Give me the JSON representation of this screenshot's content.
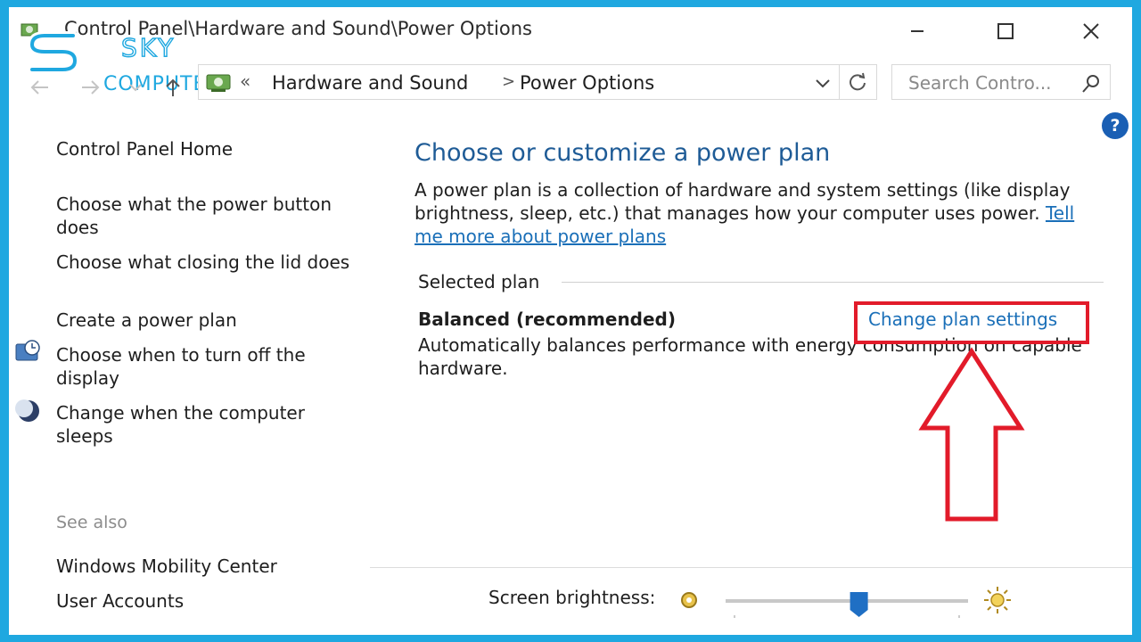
{
  "window": {
    "title": "Control Panel\\Hardware and Sound\\Power Options"
  },
  "logo": {
    "line1": "SKY",
    "line2": "COMPUTER"
  },
  "address_bar": {
    "overflow": "«",
    "crumbs": [
      "Hardware and Sound",
      "Power Options"
    ],
    "separator": ">"
  },
  "search": {
    "placeholder": "Search Contro..."
  },
  "help": {
    "label": "?"
  },
  "sidebar": {
    "home": "Control Panel Home",
    "items": [
      {
        "label": "Choose what the power button does"
      },
      {
        "label": "Choose what closing the lid does"
      },
      {
        "label": "Create a power plan"
      },
      {
        "label": "Choose when to turn off the display",
        "icon": "clock-monitor-icon"
      },
      {
        "label": "Change when the computer sleeps",
        "icon": "moon-icon"
      }
    ],
    "see_also_label": "See also",
    "see_also": [
      "Windows Mobility Center",
      "User Accounts"
    ]
  },
  "main": {
    "heading": "Choose or customize a power plan",
    "description": "A power plan is a collection of hardware and system settings (like display brightness, sleep, etc.) that manages how your computer uses power.",
    "learn_more_link": "Tell me more about power plans",
    "selected_plan_label": "Selected plan",
    "plan": {
      "name": "Balanced (recommended)",
      "settings_link": "Change plan settings",
      "description": "Automatically balances performance with energy consumption on capable hardware."
    }
  },
  "bottom": {
    "brightness_label": "Screen brightness:",
    "brightness_level": 0.55
  },
  "colors": {
    "accent": "#1a6fb8",
    "heading": "#1e5b96",
    "highlight": "#e21b2a",
    "frame": "#1fa8e0"
  }
}
